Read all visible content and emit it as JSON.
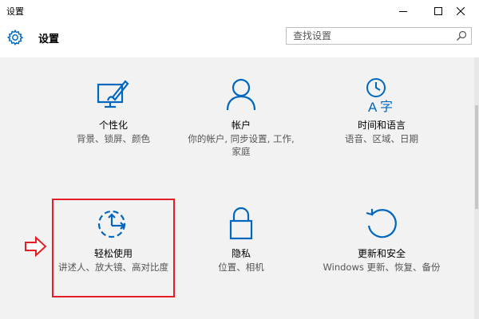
{
  "window": {
    "title": "设置",
    "controls": [
      "minimize",
      "maximize",
      "close"
    ]
  },
  "header": {
    "title": "设置",
    "icon": "gear-icon",
    "search_placeholder": "查找设置",
    "search_icon": "search-icon"
  },
  "tiles": [
    {
      "name": "个性化",
      "desc": "背景、锁屏、颜色",
      "icon": "personalization-icon"
    },
    {
      "name": "帐户",
      "desc": "你的帐户, 同步设置, 工作, 家庭",
      "icon": "accounts-icon"
    },
    {
      "name": "时间和语言",
      "desc": "语音、区域、日期",
      "icon": "time-language-icon"
    },
    {
      "name": "轻松使用",
      "desc": "讲述人、放大镜、高对比度",
      "icon": "ease-of-access-icon"
    },
    {
      "name": "隐私",
      "desc": "位置、相机",
      "icon": "lock-icon"
    },
    {
      "name": "更新和安全",
      "desc": "Windows 更新、恢复、备份",
      "icon": "update-icon"
    }
  ],
  "colors": {
    "accent": "#0067c0",
    "highlight": "#e51e25",
    "background": "#f2f2f2"
  }
}
